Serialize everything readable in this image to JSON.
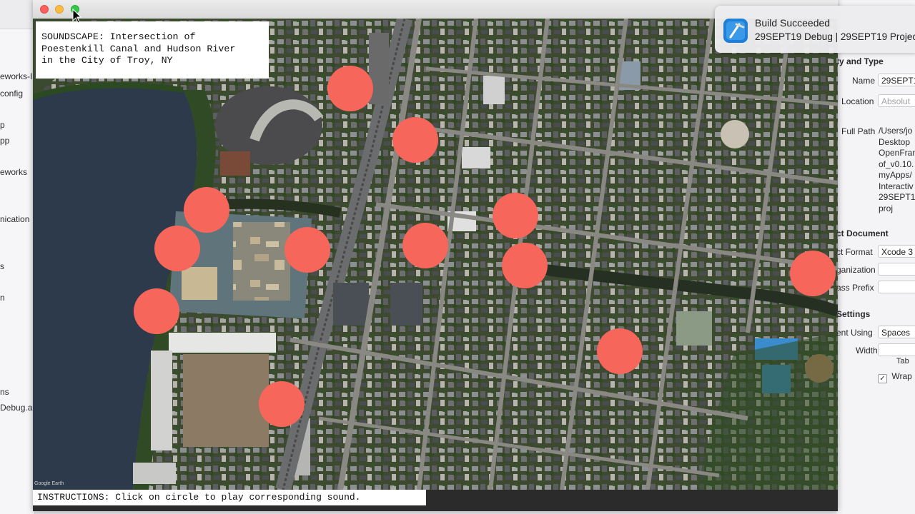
{
  "app": {
    "title_lines": [
      "SOUNDSCAPE: Intersection of",
      "Poestenkill Canal and Hudson River",
      "in the City of Troy, NY"
    ],
    "instructions": "INSTRUCTIONS: Click on circle to play corresponding sound.",
    "circle_color": "#f7665a",
    "map_watermark": "Google Earth"
  },
  "notification": {
    "title": "Build Succeeded",
    "body": "29SEPT19 Debug | 29SEPT19 Project"
  },
  "xcode_left": {
    "items": [
      "eworks-I",
      "config",
      "p",
      "pp",
      "eworks",
      "nication",
      "s",
      "n",
      "ns",
      "Debug.a"
    ]
  },
  "xcode_right": {
    "section_identity": "ty and Type",
    "name_label": "Name",
    "name_value": "29SEPT1",
    "location_label": "Location",
    "location_value": "Absolut",
    "full_path_label": "Full Path",
    "full_path_lines": [
      "/Users/jo",
      "Desktop",
      "OpenFran",
      "of_v0.10.",
      "myApps/",
      "Interactiv",
      "29SEPT1",
      "proj"
    ],
    "section_document": "ct Document",
    "format_label": "ct Format",
    "format_value": "Xcode 3",
    "org_label": "ganization",
    "prefix_label": "ass Prefix",
    "section_settings": "Settings",
    "indent_label": "ent Using",
    "indent_value": "Spaces",
    "widths_label": "Widths",
    "tab_label": "Tab",
    "wrap_label": "Wrap"
  }
}
